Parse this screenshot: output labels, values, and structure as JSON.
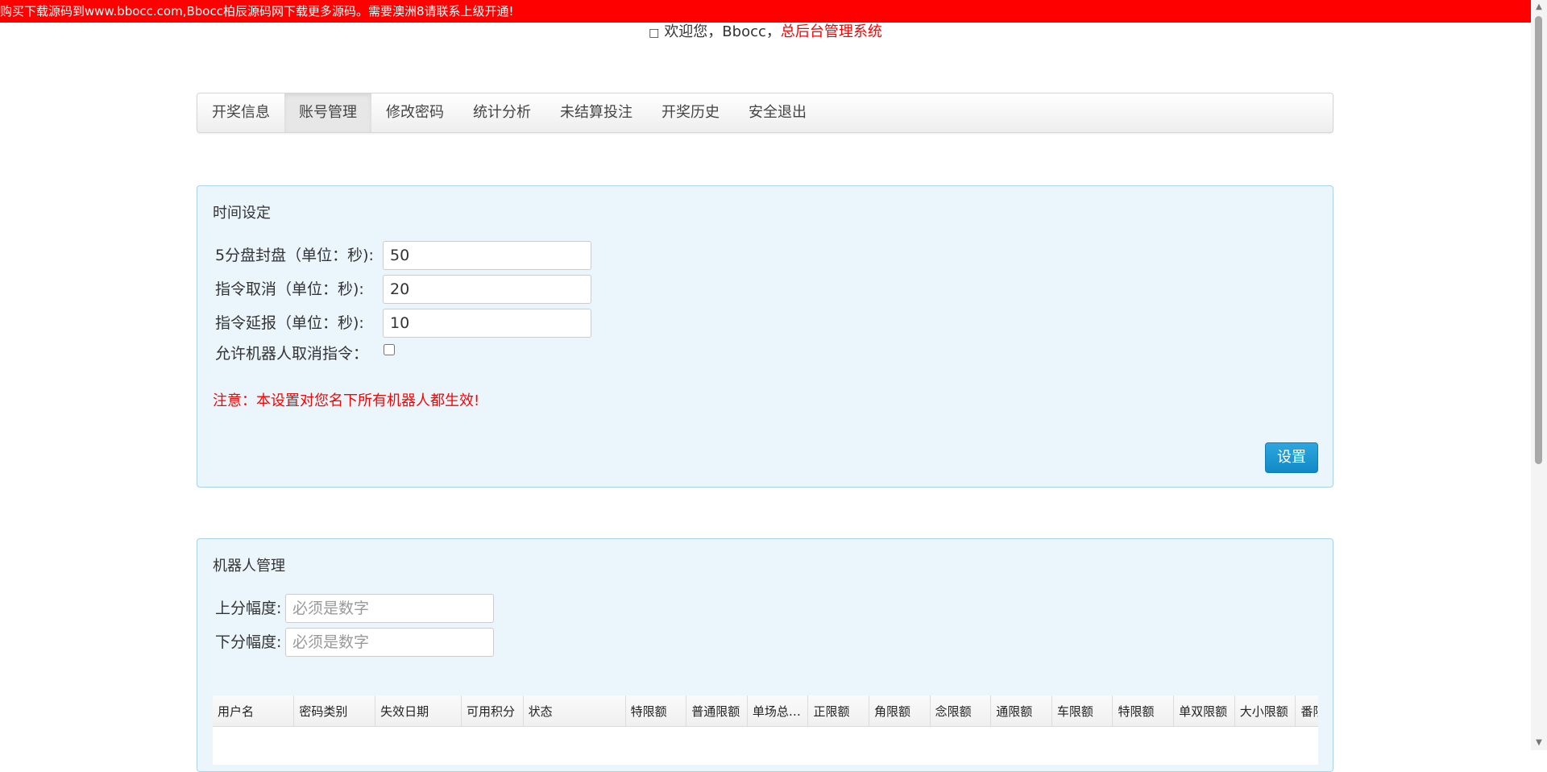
{
  "banner": {
    "text": "购买下载源码到www.bbocc.com,Bbocc柏辰源码网下载更多源码。需要澳洲8请联系上级开通!"
  },
  "header": {
    "welcome": "欢迎您，Bbocc，",
    "system_name": "总后台管理系统"
  },
  "nav": {
    "items": [
      {
        "label": "开奖信息"
      },
      {
        "label": "账号管理",
        "active": true
      },
      {
        "label": "修改密码"
      },
      {
        "label": "统计分析"
      },
      {
        "label": "未结算投注"
      },
      {
        "label": "开奖历史"
      },
      {
        "label": "安全退出"
      }
    ]
  },
  "time_settings": {
    "title": "时间设定",
    "fields": [
      {
        "label": "5分盘封盘（单位：秒):",
        "value": "50"
      },
      {
        "label": "指令取消（单位：秒):",
        "value": "20"
      },
      {
        "label": "指令延报（单位：秒):",
        "value": "10"
      }
    ],
    "robot_cancel_label": "允许机器人取消指令：",
    "robot_cancel_checked": false,
    "note": "注意：本设置对您名下所有机器人都生效!",
    "submit_label": "设置"
  },
  "robot_management": {
    "title": "机器人管理",
    "up_label": "上分幅度:",
    "up_placeholder": "必须是数字",
    "down_label": "下分幅度:",
    "down_placeholder": "必须是数字",
    "columns": [
      "用户名",
      "密码类别",
      "失效日期",
      "可用积分",
      "状态",
      "特限额",
      "普通限额",
      "单场总限额",
      "正限额",
      "角限额",
      "念限额",
      "通限额",
      "车限额",
      "特限额",
      "单双限额",
      "大小限额",
      "番限额"
    ]
  },
  "colors": {
    "banner": "#ff0000",
    "panel_bg": "#ebf5fc",
    "panel_border": "#a9d2ea",
    "button": "#1a96d4",
    "note": "#ff0000"
  }
}
